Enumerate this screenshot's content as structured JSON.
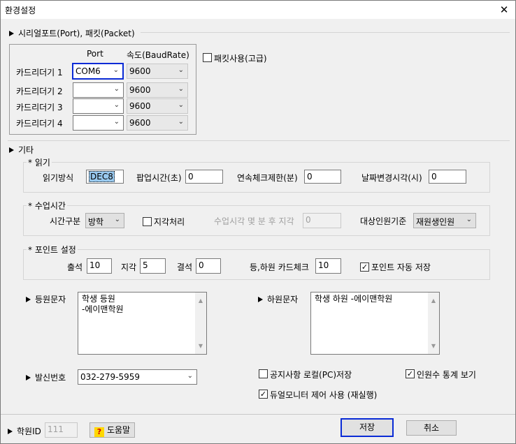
{
  "window": {
    "title": "환경설정",
    "close": "✕"
  },
  "serial": {
    "legend": "시리얼포트(Port), 패킷(Packet)",
    "col_port": "Port",
    "col_baud": "속도(BaudRate)",
    "readers": [
      {
        "label": "카드리더기 1",
        "port": "COM6",
        "baud": "9600"
      },
      {
        "label": "카드리더기 2",
        "port": "",
        "baud": "9600"
      },
      {
        "label": "카드리더기 3",
        "port": "",
        "baud": "9600"
      },
      {
        "label": "카드리더기 4",
        "port": "",
        "baud": "9600"
      }
    ],
    "packet_use": {
      "label": "패킷사용(고급)",
      "checked": false
    }
  },
  "etc": {
    "legend": "기타"
  },
  "read": {
    "legend": "* 읽기",
    "method_label": "읽기방식",
    "method_value": "DEC8",
    "popup_label": "팝업시간(초)",
    "popup_value": "0",
    "repeat_label": "연속체크제한(분)",
    "repeat_value": "0",
    "date_label": "날짜변경시각(시)",
    "date_value": "0"
  },
  "class_time": {
    "legend": "* 수업시간",
    "division_label": "시간구분",
    "division_value": "방학",
    "late_label": "지각처리",
    "late_checked": false,
    "late_after_label": "수업시각 몇 분 후 지각",
    "late_after_value": "0",
    "target_label": "대상인원기준",
    "target_value": "재원생인원"
  },
  "points": {
    "legend": "* 포인트 설정",
    "attend_label": "출석",
    "attend_value": "10",
    "late_label": "지각",
    "late_value": "5",
    "absent_label": "결석",
    "absent_value": "0",
    "card_label": "등,하원 카드체크",
    "card_value": "10",
    "auto_save_label": "포인트 자동 저장",
    "auto_save_checked": true
  },
  "messages": {
    "in_label": "등원문자",
    "in_line1": "학생 등원",
    "in_line2": "-에이맨학원",
    "out_label": "하원문자",
    "out_line1": "학생 하원 -에이맨학원"
  },
  "sender": {
    "label": "발신번호",
    "value": "032-279-5959"
  },
  "options": {
    "notice_local": {
      "label": "공지사항 로컬(PC)저장",
      "checked": false
    },
    "stats_view": {
      "label": "인원수 통계 보기",
      "checked": true
    },
    "dual_monitor": {
      "label": "듀얼모니터 제어 사용 (재실행)",
      "checked": true
    }
  },
  "footer": {
    "academy_id_label": "학원ID",
    "academy_id_value": "111",
    "help_label": "도움말",
    "help_icon": "?",
    "save_label": "저장",
    "cancel_label": "취소"
  }
}
